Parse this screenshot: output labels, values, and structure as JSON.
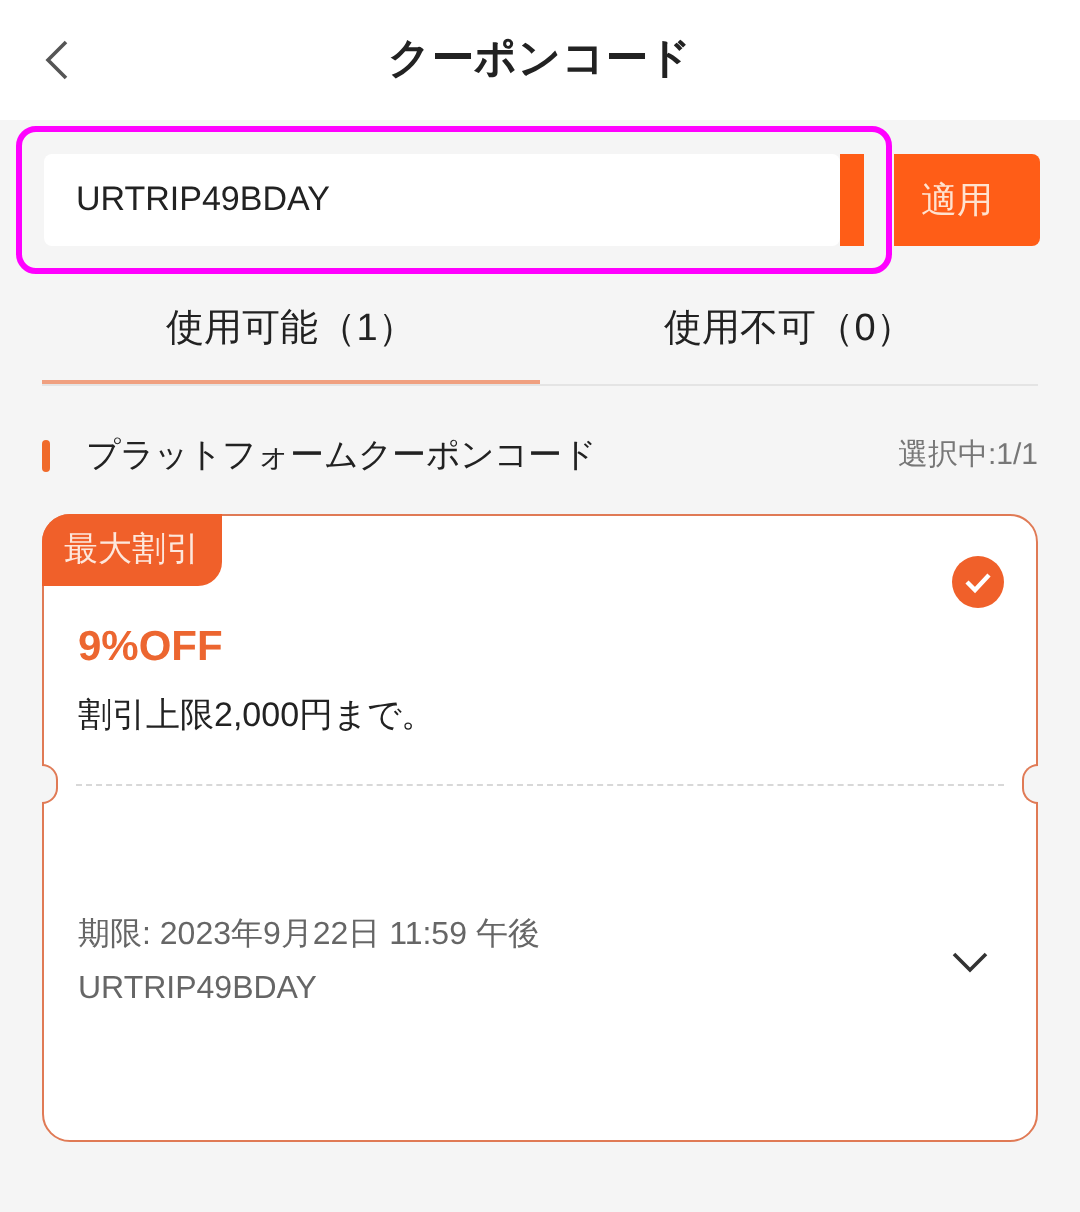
{
  "header": {
    "title": "クーポンコード"
  },
  "code_entry": {
    "value": "URTRIP49BDAY",
    "highlighted": true,
    "apply_button": "適用"
  },
  "tabs": [
    {
      "label": "使用可能（1）",
      "selected": true
    },
    {
      "label": "使用不可（0）",
      "selected": false
    }
  ],
  "section": {
    "title": "プラットフォームクーポンコード",
    "selection_count": "選択中:1/1"
  },
  "coupons": [
    {
      "badge": "最大割引",
      "discount": "9%OFF",
      "limit": "割引上限2,000円まで。",
      "expiry": "期限: 2023年9月22日 11:59 午後",
      "code": "URTRIP49BDAY",
      "selected": true,
      "expanded": false
    }
  ]
}
